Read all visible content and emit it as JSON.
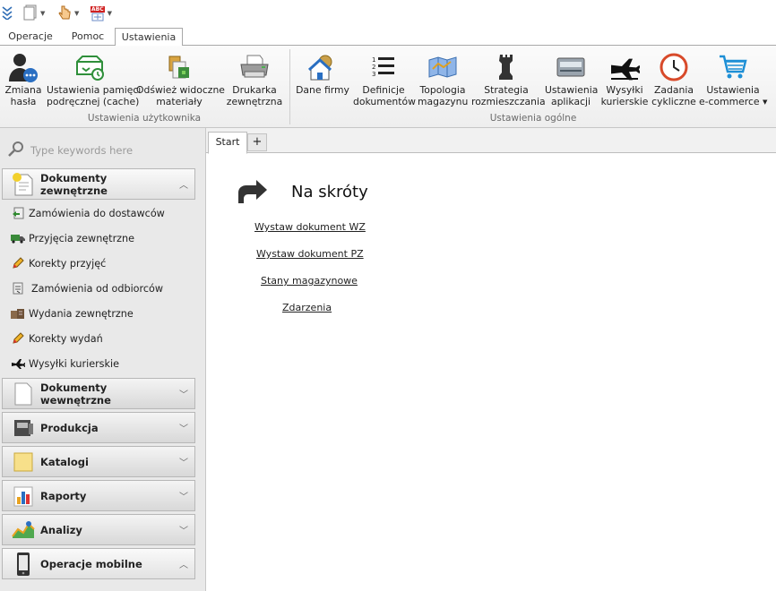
{
  "quick_access": [
    {
      "icon": "double-chevron-down-icon"
    },
    {
      "icon": "document-icon",
      "has_menu": true
    },
    {
      "icon": "hand-pointer-icon",
      "has_menu": true
    },
    {
      "icon": "spellcheck-abc-icon",
      "label": "ABC",
      "has_menu": true
    }
  ],
  "ribbon_tabs": [
    "Operacje",
    "Pomoc",
    "Ustawienia"
  ],
  "active_ribbon_tab": "Ustawienia",
  "ribbon": {
    "groups": [
      {
        "label": "Ustawienia użytkownika",
        "buttons": [
          {
            "line1": "Zmiana",
            "line2": "hasła",
            "icon": "user-password-icon"
          },
          {
            "line1": "Ustawienia pamięci",
            "line2": "podręcznej (cache)",
            "icon": "cache-settings-icon"
          },
          {
            "line1": "Odśwież widoczne",
            "line2": "materiały",
            "icon": "refresh-materials-icon"
          },
          {
            "line1": "Drukarka",
            "line2": "zewnętrzna",
            "icon": "printer-icon"
          }
        ]
      },
      {
        "label": "Ustawienia ogólne",
        "buttons": [
          {
            "line1": "Dane firmy",
            "line2": "",
            "icon": "company-house-icon"
          },
          {
            "line1": "Definicje",
            "line2": "dokumentów",
            "icon": "numbered-list-icon"
          },
          {
            "line1": "Topologia",
            "line2": "magazynu",
            "icon": "warehouse-topology-icon"
          },
          {
            "line1": "Strategia",
            "line2": "rozmieszczania",
            "icon": "chess-rook-icon"
          },
          {
            "line1": "Ustawienia",
            "line2": "aplikacji",
            "icon": "application-settings-icon"
          },
          {
            "line1": "Wysyłki",
            "line2": "kurierskie",
            "icon": "airplane-icon"
          },
          {
            "line1": "Zadania",
            "line2": "cykliczne",
            "icon": "clock-icon"
          },
          {
            "line1": "Ustawienia",
            "line2": "e-commerce ▾",
            "icon": "shopping-cart-icon"
          }
        ]
      }
    ]
  },
  "search": {
    "placeholder": "Type keywords here"
  },
  "nav": {
    "sections": [
      {
        "title": "Dokumenty zewnętrzne",
        "expanded": true,
        "icon": "external-documents-icon",
        "items": [
          {
            "label": "Zamówienia do dostawców",
            "icon": "supplier-order-icon"
          },
          {
            "label": "Przyjęcia zewnętrzne",
            "icon": "truck-icon"
          },
          {
            "label": "Korekty przyjęć",
            "icon": "pencil-icon"
          },
          {
            "label": "Zamówienia od odbiorców",
            "icon": "customer-order-icon"
          },
          {
            "label": "Wydania zewnętrzne",
            "icon": "boxes-icon"
          },
          {
            "label": "Korekty wydań",
            "icon": "pencil-icon"
          },
          {
            "label": "Wysyłki kurierskie",
            "icon": "airplane-icon"
          }
        ]
      },
      {
        "title": "Dokumenty wewnętrzne",
        "expanded": false,
        "icon": "internal-document-icon"
      },
      {
        "title": "Produkcja",
        "expanded": false,
        "icon": "production-machine-icon"
      },
      {
        "title": "Katalogi",
        "expanded": false,
        "icon": "catalog-icon"
      },
      {
        "title": "Raporty",
        "expanded": false,
        "icon": "bar-chart-icon"
      },
      {
        "title": "Analizy",
        "expanded": false,
        "icon": "analysis-chart-icon"
      },
      {
        "title": "Operacje mobilne",
        "expanded": true,
        "icon": "mobile-phone-icon"
      }
    ]
  },
  "doc_tabs": [
    "Start",
    "+"
  ],
  "shortcuts": {
    "title": "Na skróty",
    "links": [
      "Wystaw dokument WZ",
      "Wystaw dokument PZ",
      "Stany magazynowe",
      "Zdarzenia"
    ]
  }
}
